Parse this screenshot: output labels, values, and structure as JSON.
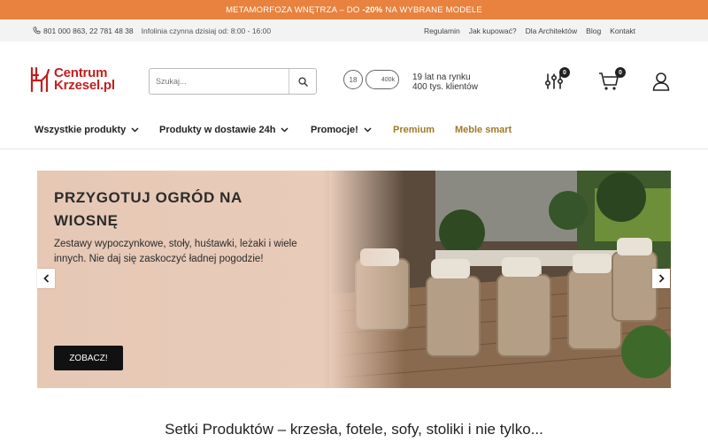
{
  "promo": {
    "pre": "METAMORFOZA WNĘTRZA – DO",
    "highlight": "-20%",
    "post": "NA WYBRANE MODELE"
  },
  "info_bar": {
    "phones": "801 000 863, 22 781 48 38",
    "hours": "Infolinia czynna dzisiaj od: 8:00 - 16:00",
    "links": [
      "Regulamin",
      "Jak kupować?",
      "Dla Architektów",
      "Blog",
      "Kontakt"
    ]
  },
  "header": {
    "logo_line1": "Centrum",
    "logo_line2": "Krzesel.pl",
    "search_placeholder": "Szukaj...",
    "badge_years": "18",
    "badge_clients": "400k",
    "trust_line1": "19 lat na rynku",
    "trust_line2": "400 tys. klientów",
    "compare_count": "0",
    "cart_count": "0"
  },
  "nav": {
    "items": [
      "Wszystkie produkty",
      "Produkty w dostawie 24h",
      "Promocje!",
      "Premium",
      "Meble smart"
    ]
  },
  "hero": {
    "title": "PRZYGOTUJ OGRÓD NA WIOSNĘ",
    "description": "Zestawy wypoczynkowe, stoły, huśtawki, leżaki i wiele innych. Nie daj się zaskoczyć ładnej pogodzie!",
    "cta": "ZOBACZ!"
  },
  "section": {
    "heading": "Setki Produktów – krzesła, fotele, sofy, stoliki i nie tylko..."
  },
  "colors": {
    "promo_bar": "#e8823e",
    "logo": "#c41e1e",
    "gold_nav": "#a07a2a",
    "cta_bg": "#111111"
  },
  "icons": [
    "phone-icon",
    "search-icon",
    "compare-icon",
    "cart-icon",
    "user-icon",
    "chevron-down-icon",
    "chevron-left-icon",
    "chevron-right-icon"
  ]
}
